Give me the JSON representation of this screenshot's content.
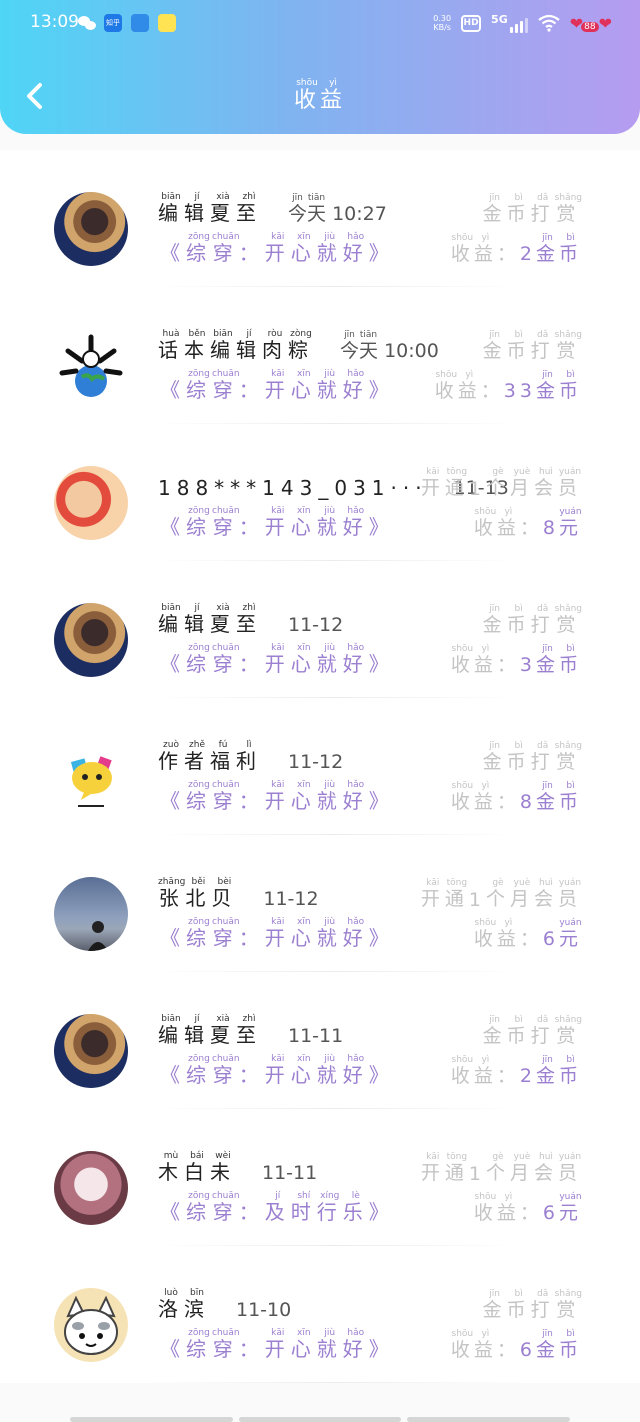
{
  "status_bar": {
    "time": "13:09",
    "zhihu_label": "知乎",
    "net_speed_value": "0.30",
    "net_speed_unit": "KB/s",
    "hd_label": "HD",
    "network_label": "5G",
    "battery_label": "88"
  },
  "header": {
    "title": [
      {
        "char": "收",
        "py": "shōu"
      },
      {
        "char": "益",
        "py": "yì"
      }
    ]
  },
  "items": [
    {
      "name": [
        {
          "c": "编",
          "p": "biān"
        },
        {
          "c": "辑",
          "p": "jí"
        },
        {
          "c": "夏",
          "p": "xià"
        },
        {
          "c": "至",
          "p": "zhì"
        }
      ],
      "time": [
        {
          "c": "今",
          "p": "jīn"
        },
        {
          "c": "天",
          "p": "tiān"
        },
        {
          "c": " 10:27",
          "p": ""
        }
      ],
      "book": [
        {
          "c": "《",
          "p": ""
        },
        {
          "c": "综",
          "p": "zōng"
        },
        {
          "c": "穿",
          "p": "chuān"
        },
        {
          "c": "：",
          "p": ""
        },
        {
          "c": "开",
          "p": "kāi"
        },
        {
          "c": "心",
          "p": "xīn"
        },
        {
          "c": "就",
          "p": "jiù"
        },
        {
          "c": "好",
          "p": "hǎo"
        },
        {
          "c": "》",
          "p": ""
        }
      ],
      "type": [
        {
          "c": "金",
          "p": "jīn"
        },
        {
          "c": "币",
          "p": "bì"
        },
        {
          "c": "打",
          "p": "dǎ"
        },
        {
          "c": "赏",
          "p": "shǎng"
        }
      ],
      "earn_label": [
        {
          "c": "收",
          "p": "shōu"
        },
        {
          "c": "益",
          "p": "yì"
        },
        {
          "c": "：",
          "p": ""
        }
      ],
      "earn_value": [
        {
          "c": "2",
          "p": ""
        },
        {
          "c": "金",
          "p": "jīn"
        },
        {
          "c": "币",
          "p": "bì"
        }
      ]
    },
    {
      "name": [
        {
          "c": "话",
          "p": "huà"
        },
        {
          "c": "本",
          "p": "běn"
        },
        {
          "c": "编",
          "p": "biān"
        },
        {
          "c": "辑",
          "p": "jí"
        },
        {
          "c": "肉",
          "p": "ròu"
        },
        {
          "c": "粽",
          "p": "zòng"
        }
      ],
      "time": [
        {
          "c": "今",
          "p": "jīn"
        },
        {
          "c": "天",
          "p": "tiān"
        },
        {
          "c": " 10:00",
          "p": ""
        }
      ],
      "book": [
        {
          "c": "《",
          "p": ""
        },
        {
          "c": "综",
          "p": "zōng"
        },
        {
          "c": "穿",
          "p": "chuān"
        },
        {
          "c": "：",
          "p": ""
        },
        {
          "c": "开",
          "p": "kāi"
        },
        {
          "c": "心",
          "p": "xīn"
        },
        {
          "c": "就",
          "p": "jiù"
        },
        {
          "c": "好",
          "p": "hǎo"
        },
        {
          "c": "》",
          "p": ""
        }
      ],
      "type": [
        {
          "c": "金",
          "p": "jīn"
        },
        {
          "c": "币",
          "p": "bì"
        },
        {
          "c": "打",
          "p": "dǎ"
        },
        {
          "c": "赏",
          "p": "shǎng"
        }
      ],
      "earn_label": [
        {
          "c": "收",
          "p": "shōu"
        },
        {
          "c": "益",
          "p": "yì"
        },
        {
          "c": "：",
          "p": ""
        }
      ],
      "earn_value": [
        {
          "c": "33",
          "p": ""
        },
        {
          "c": "金",
          "p": "jīn"
        },
        {
          "c": "币",
          "p": "bì"
        }
      ]
    },
    {
      "name": [
        {
          "c": "188***143_031···",
          "p": ""
        }
      ],
      "time": [
        {
          "c": "11-13",
          "p": ""
        }
      ],
      "book": [
        {
          "c": "《",
          "p": ""
        },
        {
          "c": "综",
          "p": "zōng"
        },
        {
          "c": "穿",
          "p": "chuān"
        },
        {
          "c": "：",
          "p": ""
        },
        {
          "c": "开",
          "p": "kāi"
        },
        {
          "c": "心",
          "p": "xīn"
        },
        {
          "c": "就",
          "p": "jiù"
        },
        {
          "c": "好",
          "p": "hǎo"
        },
        {
          "c": "》",
          "p": ""
        }
      ],
      "type": [
        {
          "c": "开",
          "p": "kāi"
        },
        {
          "c": "通",
          "p": "tōng"
        },
        {
          "c": "1",
          "p": ""
        },
        {
          "c": "个",
          "p": "gè"
        },
        {
          "c": "月",
          "p": "yuè"
        },
        {
          "c": "会",
          "p": "huì"
        },
        {
          "c": "员",
          "p": "yuán"
        }
      ],
      "earn_label": [
        {
          "c": "收",
          "p": "shōu"
        },
        {
          "c": "益",
          "p": "yì"
        },
        {
          "c": "：",
          "p": ""
        }
      ],
      "earn_value": [
        {
          "c": "8",
          "p": ""
        },
        {
          "c": "元",
          "p": "yuán"
        }
      ]
    },
    {
      "name": [
        {
          "c": "编",
          "p": "biān"
        },
        {
          "c": "辑",
          "p": "jí"
        },
        {
          "c": "夏",
          "p": "xià"
        },
        {
          "c": "至",
          "p": "zhì"
        }
      ],
      "time": [
        {
          "c": "11-12",
          "p": ""
        }
      ],
      "book": [
        {
          "c": "《",
          "p": ""
        },
        {
          "c": "综",
          "p": "zōng"
        },
        {
          "c": "穿",
          "p": "chuān"
        },
        {
          "c": "：",
          "p": ""
        },
        {
          "c": "开",
          "p": "kāi"
        },
        {
          "c": "心",
          "p": "xīn"
        },
        {
          "c": "就",
          "p": "jiù"
        },
        {
          "c": "好",
          "p": "hǎo"
        },
        {
          "c": "》",
          "p": ""
        }
      ],
      "type": [
        {
          "c": "金",
          "p": "jīn"
        },
        {
          "c": "币",
          "p": "bì"
        },
        {
          "c": "打",
          "p": "dǎ"
        },
        {
          "c": "赏",
          "p": "shǎng"
        }
      ],
      "earn_label": [
        {
          "c": "收",
          "p": "shōu"
        },
        {
          "c": "益",
          "p": "yì"
        },
        {
          "c": "：",
          "p": ""
        }
      ],
      "earn_value": [
        {
          "c": "3",
          "p": ""
        },
        {
          "c": "金",
          "p": "jīn"
        },
        {
          "c": "币",
          "p": "bì"
        }
      ]
    },
    {
      "name": [
        {
          "c": "作",
          "p": "zuò"
        },
        {
          "c": "者",
          "p": "zhě"
        },
        {
          "c": "福",
          "p": "fú"
        },
        {
          "c": "利",
          "p": "lì"
        }
      ],
      "time": [
        {
          "c": "11-12",
          "p": ""
        }
      ],
      "book": [
        {
          "c": "《",
          "p": ""
        },
        {
          "c": "综",
          "p": "zōng"
        },
        {
          "c": "穿",
          "p": "chuān"
        },
        {
          "c": "：",
          "p": ""
        },
        {
          "c": "开",
          "p": "kāi"
        },
        {
          "c": "心",
          "p": "xīn"
        },
        {
          "c": "就",
          "p": "jiù"
        },
        {
          "c": "好",
          "p": "hǎo"
        },
        {
          "c": "》",
          "p": ""
        }
      ],
      "type": [
        {
          "c": "金",
          "p": "jīn"
        },
        {
          "c": "币",
          "p": "bì"
        },
        {
          "c": "打",
          "p": "dǎ"
        },
        {
          "c": "赏",
          "p": "shǎng"
        }
      ],
      "earn_label": [
        {
          "c": "收",
          "p": "shōu"
        },
        {
          "c": "益",
          "p": "yì"
        },
        {
          "c": "：",
          "p": ""
        }
      ],
      "earn_value": [
        {
          "c": "8",
          "p": ""
        },
        {
          "c": "金",
          "p": "jīn"
        },
        {
          "c": "币",
          "p": "bì"
        }
      ]
    },
    {
      "name": [
        {
          "c": "张",
          "p": "zhāng"
        },
        {
          "c": "北",
          "p": "běi"
        },
        {
          "c": "贝",
          "p": "bèi"
        }
      ],
      "time": [
        {
          "c": "11-12",
          "p": ""
        }
      ],
      "book": [
        {
          "c": "《",
          "p": ""
        },
        {
          "c": "综",
          "p": "zōng"
        },
        {
          "c": "穿",
          "p": "chuān"
        },
        {
          "c": "：",
          "p": ""
        },
        {
          "c": "开",
          "p": "kāi"
        },
        {
          "c": "心",
          "p": "xīn"
        },
        {
          "c": "就",
          "p": "jiù"
        },
        {
          "c": "好",
          "p": "hǎo"
        },
        {
          "c": "》",
          "p": ""
        }
      ],
      "type": [
        {
          "c": "开",
          "p": "kāi"
        },
        {
          "c": "通",
          "p": "tōng"
        },
        {
          "c": "1",
          "p": ""
        },
        {
          "c": "个",
          "p": "gè"
        },
        {
          "c": "月",
          "p": "yuè"
        },
        {
          "c": "会",
          "p": "huì"
        },
        {
          "c": "员",
          "p": "yuán"
        }
      ],
      "earn_label": [
        {
          "c": "收",
          "p": "shōu"
        },
        {
          "c": "益",
          "p": "yì"
        },
        {
          "c": "：",
          "p": ""
        }
      ],
      "earn_value": [
        {
          "c": "6",
          "p": ""
        },
        {
          "c": "元",
          "p": "yuán"
        }
      ]
    },
    {
      "name": [
        {
          "c": "编",
          "p": "biān"
        },
        {
          "c": "辑",
          "p": "jí"
        },
        {
          "c": "夏",
          "p": "xià"
        },
        {
          "c": "至",
          "p": "zhì"
        }
      ],
      "time": [
        {
          "c": "11-11",
          "p": ""
        }
      ],
      "book": [
        {
          "c": "《",
          "p": ""
        },
        {
          "c": "综",
          "p": "zōng"
        },
        {
          "c": "穿",
          "p": "chuān"
        },
        {
          "c": "：",
          "p": ""
        },
        {
          "c": "开",
          "p": "kāi"
        },
        {
          "c": "心",
          "p": "xīn"
        },
        {
          "c": "就",
          "p": "jiù"
        },
        {
          "c": "好",
          "p": "hǎo"
        },
        {
          "c": "》",
          "p": ""
        }
      ],
      "type": [
        {
          "c": "金",
          "p": "jīn"
        },
        {
          "c": "币",
          "p": "bì"
        },
        {
          "c": "打",
          "p": "dǎ"
        },
        {
          "c": "赏",
          "p": "shǎng"
        }
      ],
      "earn_label": [
        {
          "c": "收",
          "p": "shōu"
        },
        {
          "c": "益",
          "p": "yì"
        },
        {
          "c": "：",
          "p": ""
        }
      ],
      "earn_value": [
        {
          "c": "2",
          "p": ""
        },
        {
          "c": "金",
          "p": "jīn"
        },
        {
          "c": "币",
          "p": "bì"
        }
      ]
    },
    {
      "name": [
        {
          "c": "木",
          "p": "mù"
        },
        {
          "c": "白",
          "p": "bái"
        },
        {
          "c": "未",
          "p": "wèi"
        }
      ],
      "time": [
        {
          "c": "11-11",
          "p": ""
        }
      ],
      "book": [
        {
          "c": "《",
          "p": ""
        },
        {
          "c": "综",
          "p": "zōng"
        },
        {
          "c": "穿",
          "p": "chuān"
        },
        {
          "c": "：",
          "p": ""
        },
        {
          "c": "及",
          "p": "jí"
        },
        {
          "c": "时",
          "p": "shí"
        },
        {
          "c": "行",
          "p": "xíng"
        },
        {
          "c": "乐",
          "p": "lè"
        },
        {
          "c": "》",
          "p": ""
        }
      ],
      "type": [
        {
          "c": "开",
          "p": "kāi"
        },
        {
          "c": "通",
          "p": "tōng"
        },
        {
          "c": "1",
          "p": ""
        },
        {
          "c": "个",
          "p": "gè"
        },
        {
          "c": "月",
          "p": "yuè"
        },
        {
          "c": "会",
          "p": "huì"
        },
        {
          "c": "员",
          "p": "yuán"
        }
      ],
      "earn_label": [
        {
          "c": "收",
          "p": "shōu"
        },
        {
          "c": "益",
          "p": "yì"
        },
        {
          "c": "：",
          "p": ""
        }
      ],
      "earn_value": [
        {
          "c": "6",
          "p": ""
        },
        {
          "c": "元",
          "p": "yuán"
        }
      ]
    },
    {
      "name": [
        {
          "c": "洛",
          "p": "luò"
        },
        {
          "c": "滨",
          "p": "bīn"
        }
      ],
      "time": [
        {
          "c": "11-10",
          "p": ""
        }
      ],
      "book": [
        {
          "c": "《",
          "p": ""
        },
        {
          "c": "综",
          "p": "zōng"
        },
        {
          "c": "穿",
          "p": "chuān"
        },
        {
          "c": "：",
          "p": ""
        },
        {
          "c": "开",
          "p": "kāi"
        },
        {
          "c": "心",
          "p": "xīn"
        },
        {
          "c": "就",
          "p": "jiù"
        },
        {
          "c": "好",
          "p": "hǎo"
        },
        {
          "c": "》",
          "p": ""
        }
      ],
      "type": [
        {
          "c": "金",
          "p": "jīn"
        },
        {
          "c": "币",
          "p": "bì"
        },
        {
          "c": "打",
          "p": "dǎ"
        },
        {
          "c": "赏",
          "p": "shǎng"
        }
      ],
      "earn_label": [
        {
          "c": "收",
          "p": "shōu"
        },
        {
          "c": "益",
          "p": "yì"
        },
        {
          "c": "：",
          "p": ""
        }
      ],
      "earn_value": [
        {
          "c": "6",
          "p": ""
        },
        {
          "c": "金",
          "p": "jīn"
        },
        {
          "c": "币",
          "p": "bì"
        }
      ]
    }
  ]
}
